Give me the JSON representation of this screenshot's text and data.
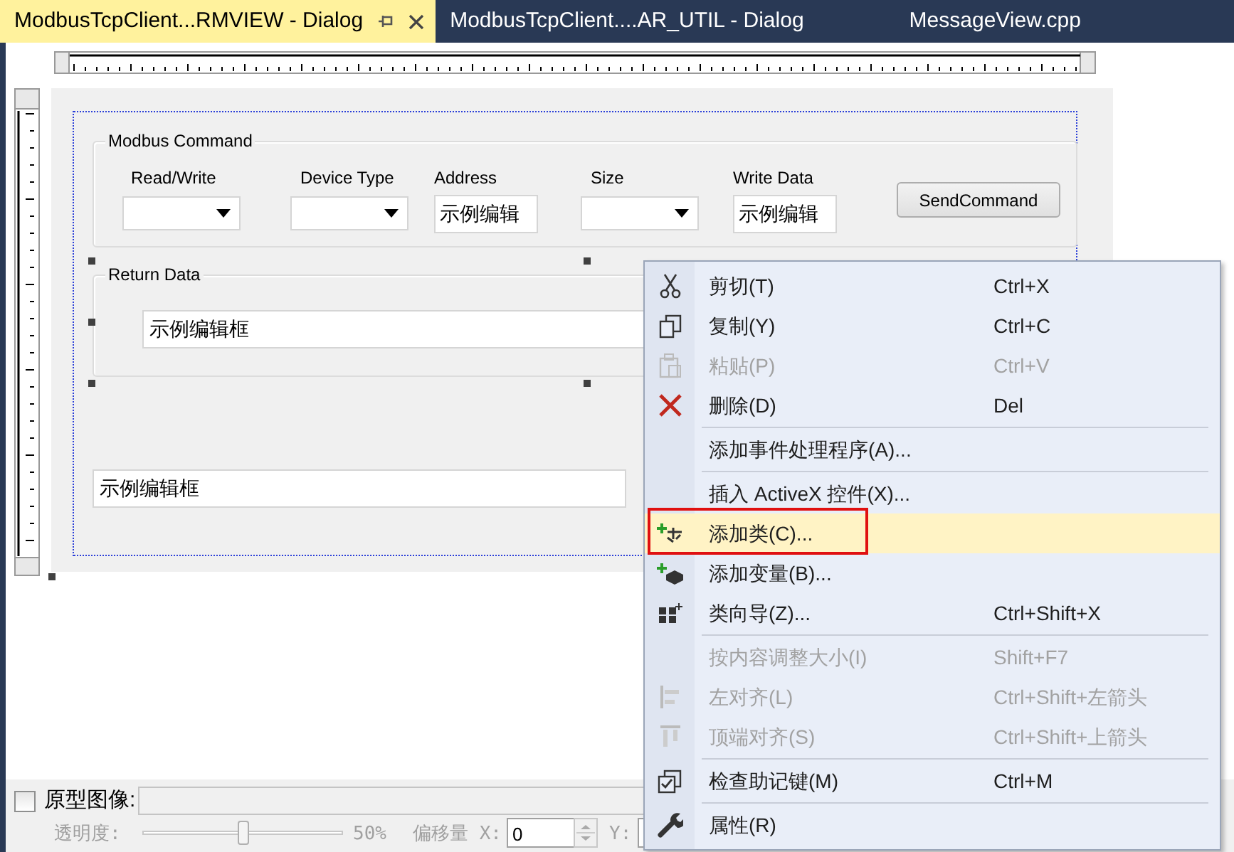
{
  "tabs": [
    {
      "label": "ModbusTcpClient...RMVIEW - Dialog",
      "selected": true
    },
    {
      "label": "ModbusTcpClient....AR_UTIL - Dialog",
      "selected": false
    },
    {
      "label": "MessageView.cpp",
      "selected": false
    }
  ],
  "dialog": {
    "command_group": {
      "title": "Modbus Command",
      "fields": [
        {
          "label": "Read/Write",
          "kind": "combo"
        },
        {
          "label": "Device Type",
          "kind": "combo"
        },
        {
          "label": "Address",
          "kind": "edit",
          "value": "示例编辑"
        },
        {
          "label": "Size",
          "kind": "combo"
        },
        {
          "label": "Write Data",
          "kind": "edit",
          "value": "示例编辑"
        }
      ],
      "button": "SendCommand"
    },
    "return_group": {
      "title": "Return Data",
      "value": "示例编辑框"
    },
    "bottom_edit": {
      "value": "示例编辑框"
    }
  },
  "prototype_bar": {
    "checkbox": {
      "label": "原型图像:",
      "checked": false
    },
    "opacity": {
      "label": "透明度:",
      "level": 0.5,
      "reading": "50%"
    },
    "offset": {
      "x_label": "偏移量 X:",
      "x_value": "0",
      "y_label": "Y:"
    }
  },
  "context_menu": [
    {
      "kind": "item",
      "label": "剪切(T)",
      "shortcut": "Ctrl+X",
      "disabled": false,
      "selected": false
    },
    {
      "kind": "item",
      "label": "复制(Y)",
      "shortcut": "Ctrl+C",
      "disabled": false,
      "selected": false
    },
    {
      "kind": "item",
      "label": "粘贴(P)",
      "shortcut": "Ctrl+V",
      "disabled": true,
      "selected": false
    },
    {
      "kind": "item",
      "label": "删除(D)",
      "shortcut": "Del",
      "disabled": false,
      "selected": false
    },
    {
      "kind": "separator"
    },
    {
      "kind": "item",
      "label": "添加事件处理程序(A)...",
      "disabled": false,
      "selected": false
    },
    {
      "kind": "separator"
    },
    {
      "kind": "item",
      "label": "插入 ActiveX 控件(X)...",
      "disabled": false,
      "selected": false
    },
    {
      "kind": "item",
      "label": "添加类(C)...",
      "disabled": false,
      "selected": true,
      "outlined": true
    },
    {
      "kind": "item",
      "label": "添加变量(B)...",
      "disabled": false,
      "selected": false
    },
    {
      "kind": "item",
      "label": "类向导(Z)...",
      "shortcut": "Ctrl+Shift+X",
      "disabled": false,
      "selected": false
    },
    {
      "kind": "separator"
    },
    {
      "kind": "item",
      "label": "按内容调整大小(I)",
      "shortcut": "Shift+F7",
      "disabled": true,
      "selected": false
    },
    {
      "kind": "item",
      "label": "左对齐(L)",
      "shortcut": "Ctrl+Shift+左箭头",
      "disabled": true,
      "selected": false
    },
    {
      "kind": "item",
      "label": "顶端对齐(S)",
      "shortcut": "Ctrl+Shift+上箭头",
      "disabled": true,
      "selected": false
    },
    {
      "kind": "separator"
    },
    {
      "kind": "item",
      "label": "检查助记键(M)",
      "shortcut": "Ctrl+M",
      "disabled": false,
      "selected": false
    },
    {
      "kind": "separator"
    },
    {
      "kind": "item",
      "label": "属性(R)",
      "disabled": false,
      "selected": false
    }
  ]
}
